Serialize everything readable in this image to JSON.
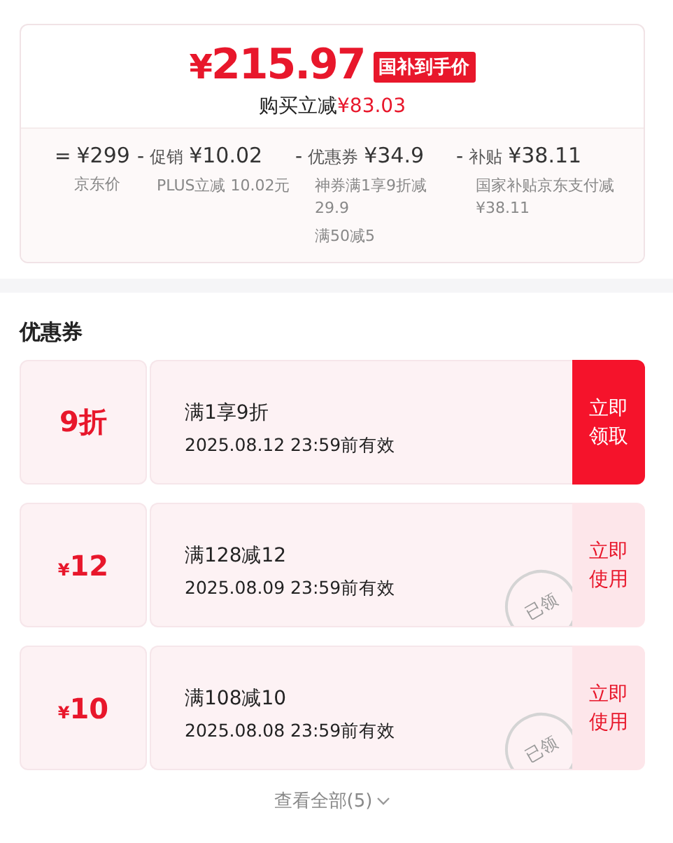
{
  "price": {
    "currency": "¥",
    "amount": "215.97",
    "badge": "国补到手价",
    "saving_label": "购买立减",
    "saving_amount": "¥83.03"
  },
  "breakdown": [
    {
      "op": "=",
      "amount": "¥299",
      "notes": [
        "京东价"
      ]
    },
    {
      "op": "-",
      "label": "促销",
      "amount": "¥10.02",
      "notes": [
        "PLUS立减 10.02元"
      ]
    },
    {
      "op": "-",
      "label": "优惠券",
      "amount": "¥34.9",
      "notes": [
        "神券满1享9折减29.9",
        "满50减5"
      ]
    },
    {
      "op": "-",
      "label": "补贴",
      "amount": "¥38.11",
      "notes": [
        "国家补贴京东支付减¥38.11"
      ]
    }
  ],
  "coupons_title": "优惠券",
  "coupons": [
    {
      "value": "9折",
      "title": "满1享9折",
      "validity": "2025.08.12 23:59前有效",
      "action": "立即领取",
      "claimed": false
    },
    {
      "currency": "¥",
      "value": "12",
      "title": "满128减12",
      "validity": "2025.08.09 23:59前有效",
      "action": "立即使用",
      "claimed": true,
      "stamp": "已领"
    },
    {
      "currency": "¥",
      "value": "10",
      "title": "满108减10",
      "validity": "2025.08.08 23:59前有效",
      "action": "立即使用",
      "claimed": true,
      "stamp": "已领"
    }
  ],
  "view_all": "查看全部(5)"
}
